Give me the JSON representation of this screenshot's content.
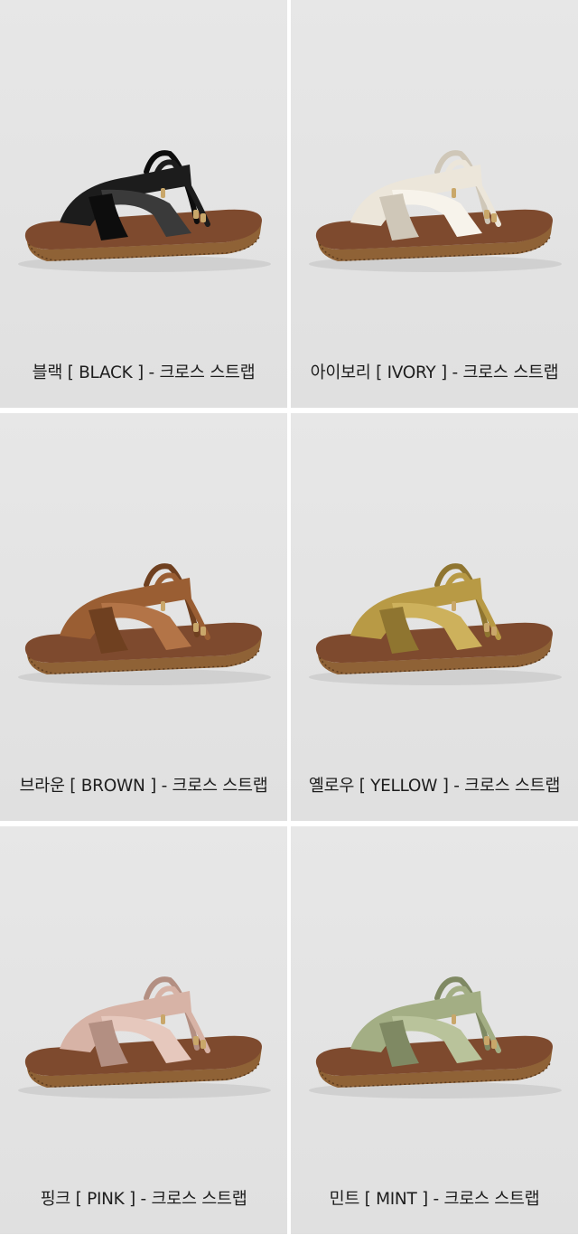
{
  "products": [
    {
      "caption": "블랙 [ BLACK ] - 크로스 스트랩",
      "color_name": "BLACK",
      "colors": {
        "strap": "#1c1c1c",
        "strap_hi": "#3a3a3a",
        "strap_dark": "#0d0d0d"
      }
    },
    {
      "caption": "아이보리 [ IVORY ] - 크로스 스트랩",
      "color_name": "IVORY",
      "colors": {
        "strap": "#ece6da",
        "strap_hi": "#f7f3eb",
        "strap_dark": "#cfc7b8"
      }
    },
    {
      "caption": "브라운 [ BROWN ] - 크로스 스트랩",
      "color_name": "BROWN",
      "colors": {
        "strap": "#9a5e33",
        "strap_hi": "#b37447",
        "strap_dark": "#6f4020"
      }
    },
    {
      "caption": "옐로우 [ YELLOW ] - 크로스 스트랩",
      "color_name": "YELLOW",
      "colors": {
        "strap": "#b89a45",
        "strap_hi": "#cdb15c",
        "strap_dark": "#8f7530"
      }
    },
    {
      "caption": "핑크 [ PINK ] - 크로스 스트랩",
      "color_name": "PINK",
      "colors": {
        "strap": "#d7b3a6",
        "strap_hi": "#e6c8bd",
        "strap_dark": "#b38f82"
      }
    },
    {
      "caption": "민트 [ MINT ] - 크로스 스트랩",
      "color_name": "MINT",
      "colors": {
        "strap": "#a3ae84",
        "strap_hi": "#b9c39b",
        "strap_dark": "#7f8963"
      }
    }
  ],
  "common_colors": {
    "insole": "#7e4a2e",
    "sole": "#8f6236",
    "sole_dark": "#5e3c1e",
    "hardware": "#c9a76a"
  }
}
